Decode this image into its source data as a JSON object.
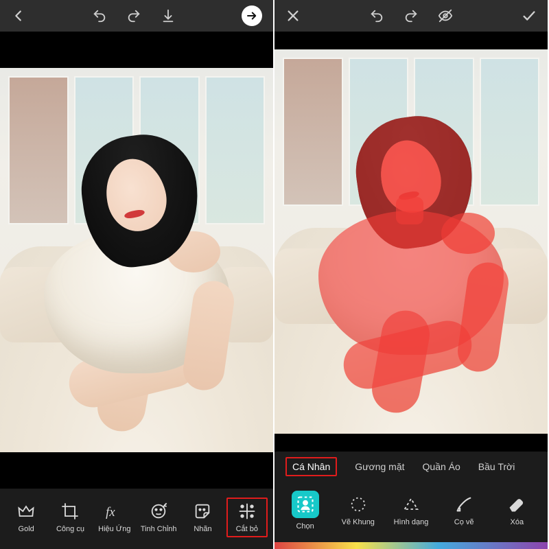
{
  "left": {
    "toolbar": {
      "back_icon": "chevron-left",
      "undo_icon": "undo",
      "redo_icon": "redo",
      "download_icon": "download",
      "next_icon": "arrow-right"
    },
    "tools": [
      {
        "id": "gold",
        "label": "Gold",
        "icon": "crown-icon"
      },
      {
        "id": "congcu",
        "label": "Công cụ",
        "icon": "crop-icon"
      },
      {
        "id": "hieuung",
        "label": "Hiệu Ứng",
        "icon": "fx-icon"
      },
      {
        "id": "tinhchinh",
        "label": "Tinh Chỉnh",
        "icon": "face-adjust-icon"
      },
      {
        "id": "nhan",
        "label": "Nhãn",
        "icon": "sticker-icon"
      },
      {
        "id": "catbo",
        "label": "Cắt bỏ",
        "icon": "cutout-icon",
        "highlighted": true
      }
    ]
  },
  "right": {
    "toolbar": {
      "close_icon": "close",
      "undo_icon": "undo",
      "redo_icon": "redo",
      "eye_icon": "eye-off",
      "confirm_icon": "checkmark"
    },
    "segments": [
      {
        "id": "canhan",
        "label": "Cá Nhân",
        "highlighted": true
      },
      {
        "id": "guongmat",
        "label": "Gương mặt"
      },
      {
        "id": "quanao",
        "label": "Quần Áo"
      },
      {
        "id": "bautroi",
        "label": "Bầu Trời"
      }
    ],
    "tools": [
      {
        "id": "chon",
        "label": "Chọn",
        "icon": "select-person-icon",
        "selected": true
      },
      {
        "id": "vekhung",
        "label": "Vẽ Khung",
        "icon": "outline-icon"
      },
      {
        "id": "hinhdang",
        "label": "Hình dạng",
        "icon": "shape-icon"
      },
      {
        "id": "cove",
        "label": "Cọ vẽ",
        "icon": "brush-icon"
      },
      {
        "id": "xoa",
        "label": "Xóa",
        "icon": "eraser-icon"
      }
    ]
  },
  "colors": {
    "highlight_border": "#e11c1c",
    "selected_bg": "#17c9c9",
    "mask_overlay": "rgba(240,60,55,.62)"
  }
}
